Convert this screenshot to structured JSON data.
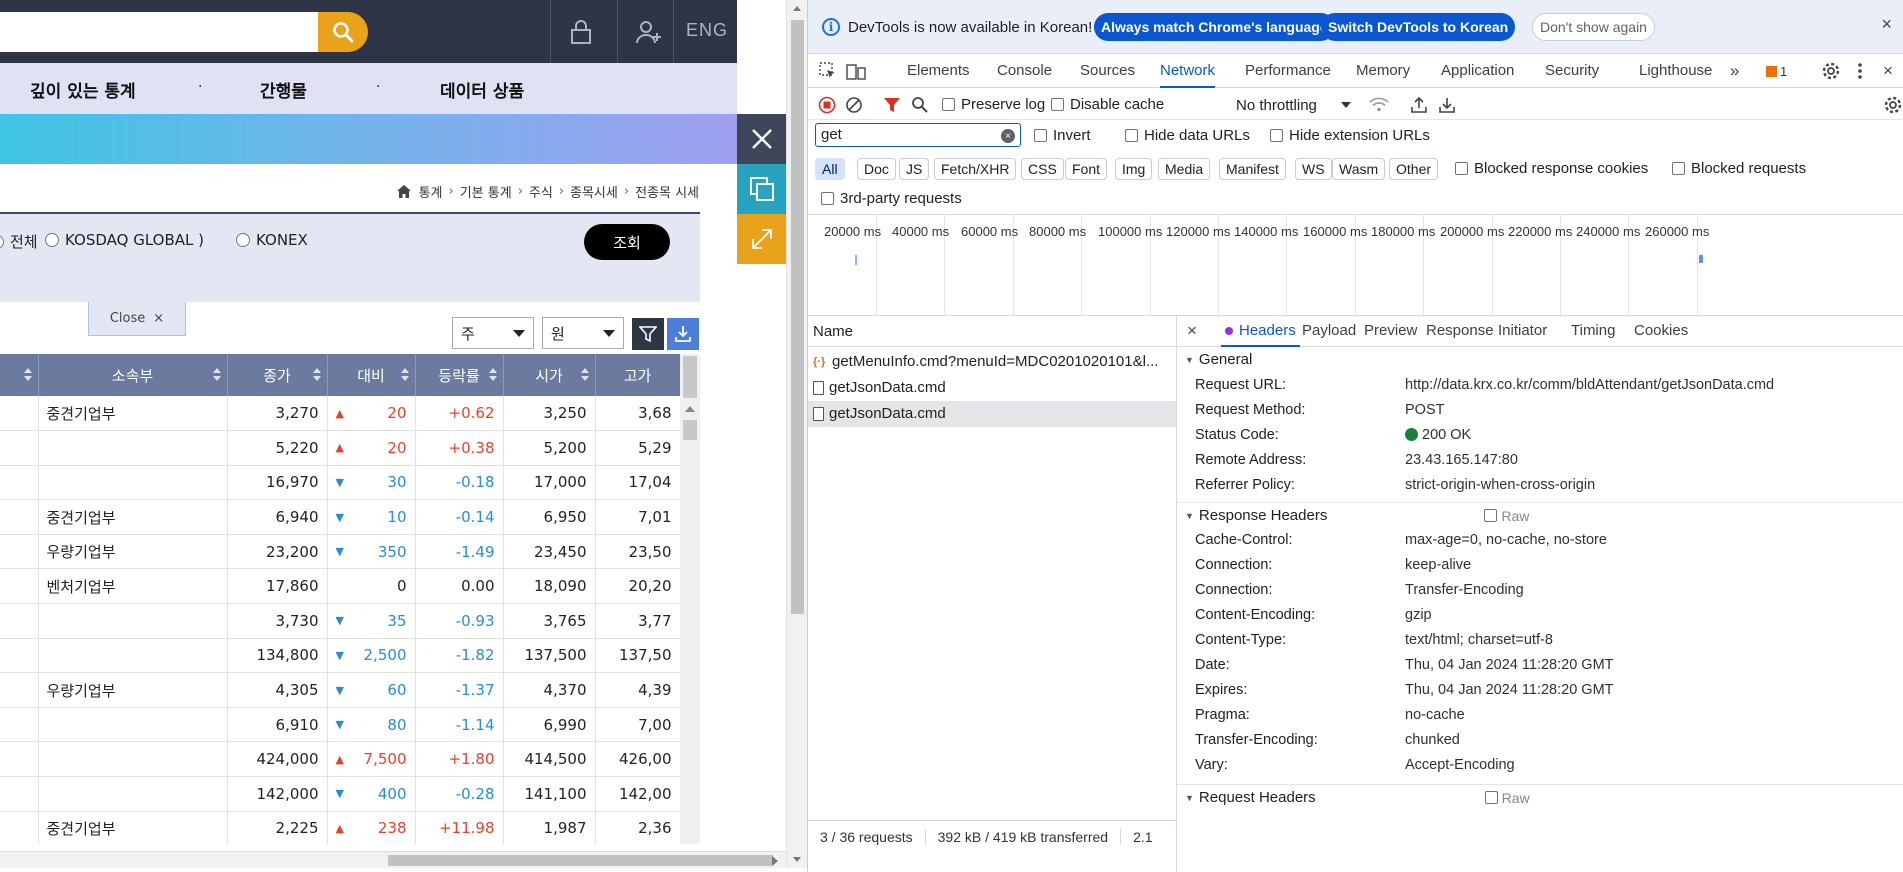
{
  "site": {
    "lang_label": "ENG",
    "menu": [
      "깊이 있는 통계",
      "간행물",
      "데이터 상품"
    ],
    "menu_sep": "·",
    "breadcrumb": [
      "통계",
      "기본 통계",
      "주식",
      "종목시세",
      "전종목 시세"
    ],
    "filter": {
      "opt1": "전체",
      "opt2": "KOSDAQ GLOBAL )",
      "opt3": "KONEX",
      "query_label": "조회"
    },
    "close_tab": {
      "label": "Close",
      "x": "×"
    },
    "unit_select": "주",
    "currency_select": "원",
    "table": {
      "headers": [
        "",
        "소속부",
        "종가",
        "대비",
        "등락률",
        "시가",
        "고가"
      ],
      "rows": [
        {
          "dept": "중견기업부",
          "close": "3,270",
          "dir": "up",
          "chg": "20",
          "rate": "+0.62",
          "open": "3,250",
          "high": "3,68"
        },
        {
          "dept": "",
          "close": "5,220",
          "dir": "up",
          "chg": "20",
          "rate": "+0.38",
          "open": "5,200",
          "high": "5,29"
        },
        {
          "dept": "",
          "close": "16,970",
          "dir": "down",
          "chg": "30",
          "rate": "-0.18",
          "open": "17,000",
          "high": "17,04"
        },
        {
          "dept": "중견기업부",
          "close": "6,940",
          "dir": "down",
          "chg": "10",
          "rate": "-0.14",
          "open": "6,950",
          "high": "7,01"
        },
        {
          "dept": "우량기업부",
          "close": "23,200",
          "dir": "down",
          "chg": "350",
          "rate": "-1.49",
          "open": "23,450",
          "high": "23,50"
        },
        {
          "dept": "벤처기업부",
          "close": "17,860",
          "dir": "none",
          "chg": "0",
          "rate": "0.00",
          "open": "18,090",
          "high": "20,20"
        },
        {
          "dept": "",
          "close": "3,730",
          "dir": "down",
          "chg": "35",
          "rate": "-0.93",
          "open": "3,765",
          "high": "3,77"
        },
        {
          "dept": "",
          "close": "134,800",
          "dir": "down",
          "chg": "2,500",
          "rate": "-1.82",
          "open": "137,500",
          "high": "137,50"
        },
        {
          "dept": "우량기업부",
          "close": "4,305",
          "dir": "down",
          "chg": "60",
          "rate": "-1.37",
          "open": "4,370",
          "high": "4,39"
        },
        {
          "dept": "",
          "close": "6,910",
          "dir": "down",
          "chg": "80",
          "rate": "-1.14",
          "open": "6,990",
          "high": "7,00"
        },
        {
          "dept": "",
          "close": "424,000",
          "dir": "up",
          "chg": "7,500",
          "rate": "+1.80",
          "open": "414,500",
          "high": "426,00"
        },
        {
          "dept": "",
          "close": "142,000",
          "dir": "down",
          "chg": "400",
          "rate": "-0.28",
          "open": "141,100",
          "high": "142,00"
        },
        {
          "dept": "중견기업부",
          "close": "2,225",
          "dir": "up",
          "chg": "238",
          "rate": "+11.98",
          "open": "1,987",
          "high": "2,36"
        }
      ]
    }
  },
  "devtools": {
    "infobar": {
      "text": "DevTools is now available in Korean!",
      "btn_match": "Always match Chrome's language",
      "btn_switch": "Switch DevTools to Korean",
      "btn_dismiss": "Don't show again"
    },
    "tabs": [
      "Elements",
      "Console",
      "Sources",
      "Network",
      "Performance",
      "Memory",
      "Application",
      "Security",
      "Lighthouse"
    ],
    "more": "»",
    "issues_count": "1",
    "toolbar": {
      "preserve_log": "Preserve log",
      "disable_cache": "Disable cache",
      "throttling": "No throttling"
    },
    "filter": {
      "value": "get",
      "invert": "Invert",
      "hide_data_urls": "Hide data URLs",
      "hide_ext_urls": "Hide extension URLs"
    },
    "types": [
      "All",
      "Doc",
      "JS",
      "Fetch/XHR",
      "CSS",
      "Font",
      "Img",
      "Media",
      "Manifest",
      "WS",
      "Wasm",
      "Other"
    ],
    "blocked_cookies": "Blocked response cookies",
    "blocked_requests": "Blocked requests",
    "third_party": "3rd-party requests",
    "timeline_ticks": [
      "20000 ms",
      "40000 ms",
      "60000 ms",
      "80000 ms",
      "100000 ms",
      "120000 ms",
      "140000 ms",
      "160000 ms",
      "180000 ms",
      "200000 ms",
      "220000 ms",
      "240000 ms",
      "260000 ms"
    ],
    "name_header": "Name",
    "requests": [
      {
        "name": "getMenuInfo.cmd?menuId=MDC0201020101&l...",
        "kind": "json"
      },
      {
        "name": "getJsonData.cmd",
        "kind": "doc"
      },
      {
        "name": "getJsonData.cmd",
        "kind": "doc"
      }
    ],
    "status": {
      "requests": "3 / 36 requests",
      "transferred": "392 kB / 419 kB transferred",
      "extra": "2.1"
    },
    "detail_tabs": [
      "Headers",
      "Payload",
      "Preview",
      "Response",
      "Initiator",
      "Timing",
      "Cookies"
    ],
    "general": {
      "title": "General",
      "rows": [
        {
          "k": "Request URL:",
          "v": "http://data.krx.co.kr/comm/bldAttendant/getJsonData.cmd"
        },
        {
          "k": "Request Method:",
          "v": "POST"
        },
        {
          "k": "Status Code:",
          "v": "200 OK"
        },
        {
          "k": "Remote Address:",
          "v": "23.43.165.147:80"
        },
        {
          "k": "Referrer Policy:",
          "v": "strict-origin-when-cross-origin"
        }
      ]
    },
    "response_headers": {
      "title": "Response Headers",
      "raw": "Raw",
      "rows": [
        {
          "k": "Cache-Control:",
          "v": "max-age=0, no-cache, no-store"
        },
        {
          "k": "Connection:",
          "v": "keep-alive"
        },
        {
          "k": "Connection:",
          "v": "Transfer-Encoding"
        },
        {
          "k": "Content-Encoding:",
          "v": "gzip"
        },
        {
          "k": "Content-Type:",
          "v": "text/html; charset=utf-8"
        },
        {
          "k": "Date:",
          "v": "Thu, 04 Jan 2024 11:28:20 GMT"
        },
        {
          "k": "Expires:",
          "v": "Thu, 04 Jan 2024 11:28:20 GMT"
        },
        {
          "k": "Pragma:",
          "v": "no-cache"
        },
        {
          "k": "Transfer-Encoding:",
          "v": "chunked"
        },
        {
          "k": "Vary:",
          "v": "Accept-Encoding"
        }
      ]
    },
    "request_headers": {
      "title": "Request Headers",
      "raw": "Raw"
    }
  }
}
